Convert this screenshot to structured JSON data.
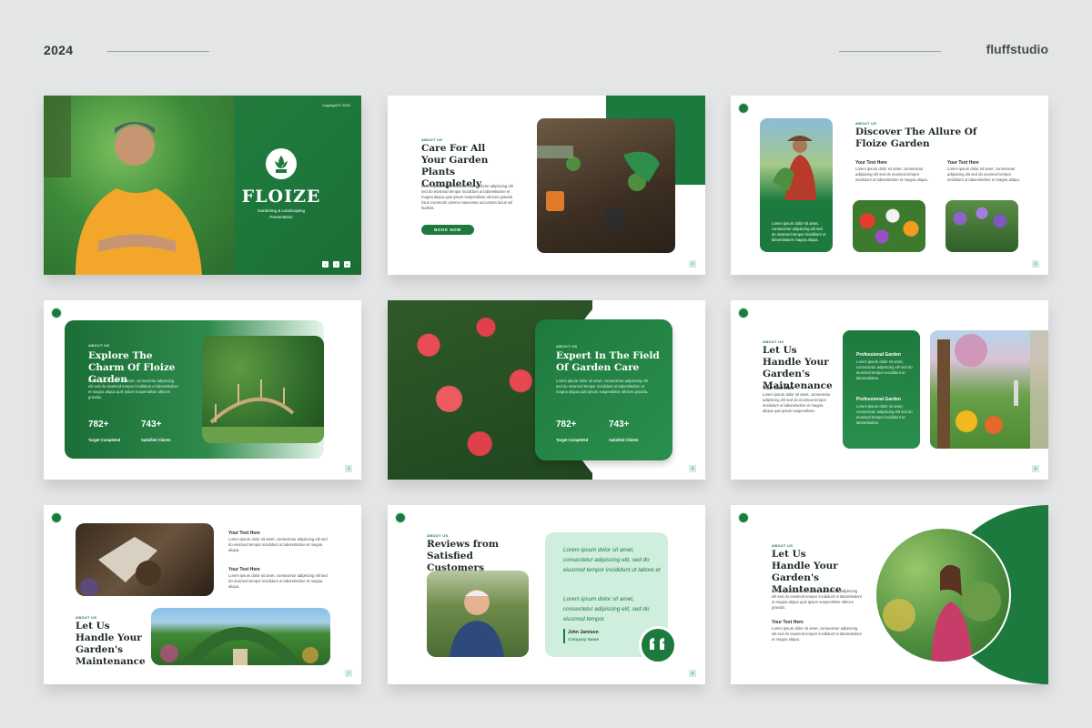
{
  "header": {
    "year": "2024",
    "brand": "fluffstudio"
  },
  "s1": {
    "copyright": "Copyright © 2024",
    "title": "FLOIZE",
    "subtitle": "Gardening & Landscaping",
    "subtitle2": "Presentation",
    "social": [
      "f",
      "t",
      "in"
    ]
  },
  "s2": {
    "tag": "ABOUT US",
    "title": "Care For All Your Garden Plants Completely",
    "body": "Lorem ipsum dolor sit amet, consectetur adipiscing elit sed do eiusmod tempor incididunt ut laboreitsdore et magna aliqua quis ipsum suspendisse ultrices gravida risus commodo viverra maecenas accumsan lacus vel facilisis.",
    "button": "BOOK NOW",
    "page": "2"
  },
  "s3": {
    "tag": "ABOUT US",
    "title": "Discover The Allure Of Floize Garden",
    "sub1": "Your Text Here",
    "sub2": "Your Text Here",
    "body1": "Lorem ipsum dolor sit amet, consectetur adipiscing elit sed do eiusmod tempor incididunt ut laboreitsdore et magna aliqua.",
    "body2": "Lorem ipsum dolor sit amet, consectetur adipiscing elit sed do eiusmod tempor incididunt ut laboreitsdore et magna aliqua.",
    "card_text": "Lorem ipsum dolor sit amet, consectetur adipiscing elit sed do eiusmod tempor incididunt ut laboreitsdore magna aliqua.",
    "page": "3"
  },
  "s4": {
    "tag": "ABOUT US",
    "title": "Explore The Charm Of Floize Garden",
    "body": "Lorem ipsum dolor sit amet, consectetur adipiscing elit sed do eiusmod tempor incididunt ut laboreitsdore et magna aliqua quis ipsum suspendisse ultrices gravida.",
    "stat1": "782+",
    "stat1_label": "Target Completed",
    "stat2": "743+",
    "stat2_label": "Satisfied Clients",
    "page": "4"
  },
  "s5": {
    "tag": "ABOUT US",
    "title": "Expert In The Field Of Garden Care",
    "body": "Lorem ipsum dolor sit amet, consectetur adipiscing elit sed do eiusmod tempor incididunt ut laboreitsdore et magna aliqua quis ipsum suspendisse ultrices gravida.",
    "stat1": "782+",
    "stat1_label": "Target Completed",
    "stat2": "743+",
    "stat2_label": "Satisfied Clients",
    "page": "5"
  },
  "s6": {
    "tag": "ABOUT US",
    "title": "Let Us Handle Your Garden's Maintenance",
    "sub": "Your Text Here",
    "body": "Lorem ipsum dolor sit amet, consectetur adipiscing elit sed do eiusmod tempor incididunt ut laboreitsdore et magna aliqua quis ipsum suspendisse.",
    "card1_title": "Professional Garden",
    "card1_body": "Lorem ipsum dolor sit amet, consectetur adipiscing elit sed do eiusmod tempor incididunt ut laboreitsdore.",
    "card2_title": "Professional Garden",
    "card2_body": "Lorem ipsum dolor sit amet, consectetur adipiscing elit sed do eiusmod tempor incididunt ut laboreitsdore.",
    "page": "6"
  },
  "s7": {
    "sub1": "Your Text Here",
    "body1": "Lorem ipsum dolor sit amet, consectetur adipiscing elit sed do eiusmod tempor incididunt ut laboreitsdore et magna aliqua.",
    "sub2": "Your Text Here",
    "body2": "Lorem ipsum dolor sit amet, consectetur adipiscing elit sed do eiusmod tempor incididunt ut laboreitsdore et magna aliqua.",
    "tag": "ABOUT US",
    "title": "Let Us Handle Your Garden's Maintenance",
    "page": "7"
  },
  "s8": {
    "tag": "ABOUT US",
    "title": "Reviews from Satisfied Customers",
    "quote1": "Lorem ipsum dolor sit amet, consectetur adipiscing elit, sed do eiusmod tempor incididunt ut labore et",
    "quote2": "Lorem ipsum dolor sit amet, consectetur adipiscing elit, sed do eiusmod tempor",
    "name": "John Jamison",
    "company": "Company Name",
    "page": "8"
  },
  "s9": {
    "tag": "ABOUT US",
    "title": "Let Us Handle Your Garden's Maintenance",
    "body": "Lorem ipsum dolor sit amet, consectetur adipiscing elit sed do eiusmod tempor incididunt ut laboreitsdore et magna aliqua quis ipsum suspendisse ultrices gravida.",
    "sub": "Your Text Here",
    "body2": "Lorem ipsum dolor sit amet, consectetur adipiscing elit sed do eiusmod tempor incididunt ut laboreitsdore et magna aliqua."
  }
}
